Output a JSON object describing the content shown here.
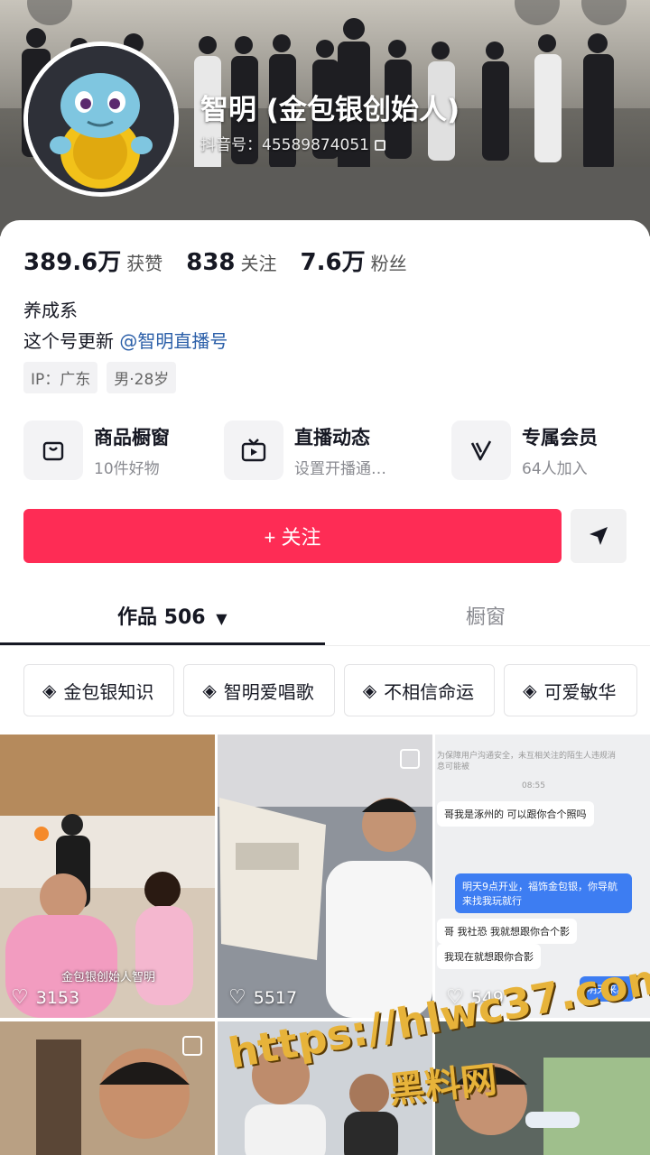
{
  "profile": {
    "nickname": "智明 (金包银创始人)",
    "douyin_id": "抖音号：45589874051"
  },
  "stats": [
    {
      "value": "389.6万",
      "label": "获赞"
    },
    {
      "value": "838",
      "label": "关注"
    },
    {
      "value": "7.6万",
      "label": "粉丝"
    }
  ],
  "bio": {
    "line1": "养成系",
    "line2_prefix": "这个号更新",
    "line2_mention": "@智明直播号"
  },
  "tags": [
    "IP：广东",
    "男·28岁"
  ],
  "services": [
    {
      "title": "商品橱窗",
      "subtitle": "10件好物",
      "icon": "shopping-bag-icon"
    },
    {
      "title": "直播动态",
      "subtitle": "设置开播通…",
      "icon": "live-tv-icon"
    },
    {
      "title": "专属会员",
      "subtitle": "64人加入",
      "icon": "vip-v-icon"
    }
  ],
  "actions": {
    "follow_label": "+ 关注"
  },
  "tabs": {
    "works_label": "作品 506",
    "shop_label": "橱窗"
  },
  "collections": [
    "金包银知识",
    "智明爱唱歌",
    "不相信命运",
    "可爱敏华"
  ],
  "videos": [
    {
      "likes": "3153",
      "caption": "金包银创始人智明"
    },
    {
      "likes": "5517"
    },
    {
      "likes": "549"
    }
  ],
  "chat_preview": {
    "header": "为保障用户沟通安全，未互相关注的陌生人违规消息可能被",
    "time": "08:55",
    "msg1": "哥我是涿州的 可以跟你合个照吗",
    "msg2": "明天9点开业，福饰金包银，你导航来找我玩就行",
    "msg3": "哥 我社恐 我就想跟你合个影",
    "msg4": "我现在就想跟你合影",
    "msg5": "明天来。"
  },
  "watermark": {
    "url": "https://hlwc37.com",
    "name": "黑料网"
  },
  "colors": {
    "follow": "#fe2c55",
    "mention": "#2a5ea8"
  }
}
